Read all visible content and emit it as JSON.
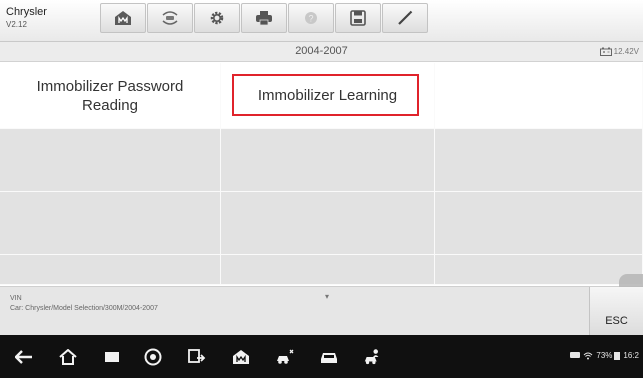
{
  "header": {
    "brand": "Chrysler",
    "version": "V2.12",
    "toolbar": [
      {
        "icon": "home-icon"
      },
      {
        "icon": "vehicle-swap-icon"
      },
      {
        "icon": "settings-gear-icon"
      },
      {
        "icon": "print-icon"
      },
      {
        "icon": "help-icon"
      },
      {
        "icon": "save-icon"
      },
      {
        "icon": "pen-icon"
      }
    ]
  },
  "subheader": {
    "model_years": "2004-2007",
    "battery_voltage": "12.42V"
  },
  "functions": [
    {
      "label_line1": "Immobilizer Password",
      "label_line2": "Reading"
    },
    {
      "label_line1": "Immobilizer Learning",
      "label_line2": ""
    }
  ],
  "footer": {
    "vin_label": "VIN",
    "path": "Car: Chrysler/Model Selection/300M/2004-2007",
    "esc_label": "ESC"
  },
  "statusbar": {
    "battery_percent": "73%",
    "time": "16:2"
  },
  "colors": {
    "highlight": "#e0232b"
  }
}
